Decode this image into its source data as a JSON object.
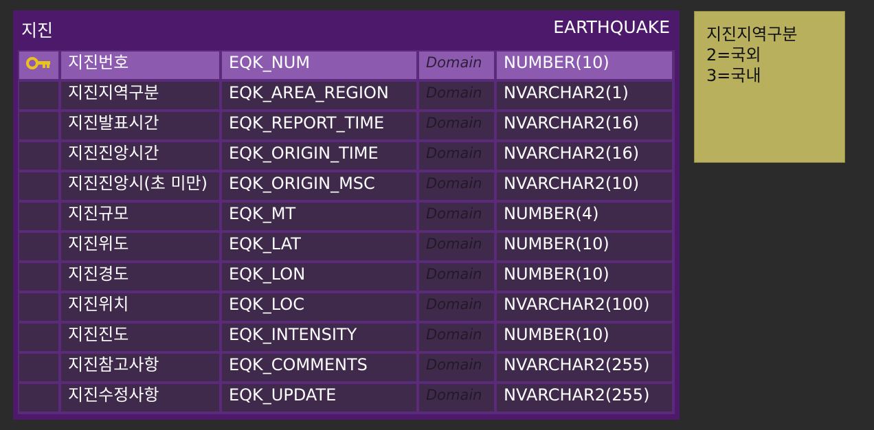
{
  "entity": {
    "logical_name": "지진",
    "physical_name": "EARTHQUAKE",
    "columns": [
      {
        "logical": "지진번호",
        "physical": "EQK_NUM",
        "domain": "Domain",
        "type": "NUMBER(10)",
        "pk": true
      },
      {
        "logical": "지진지역구분",
        "physical": "EQK_AREA_REGION",
        "domain": "Domain",
        "type": "NVARCHAR2(1)",
        "pk": false
      },
      {
        "logical": "지진발표시간",
        "physical": "EQK_REPORT_TIME",
        "domain": "Domain",
        "type": "NVARCHAR2(16)",
        "pk": false
      },
      {
        "logical": "지진진앙시간",
        "physical": "EQK_ORIGIN_TIME",
        "domain": "Domain",
        "type": "NVARCHAR2(16)",
        "pk": false
      },
      {
        "logical": "지진진앙시(초 미만)",
        "physical": "EQK_ORIGIN_MSC",
        "domain": "Domain",
        "type": "NVARCHAR2(10)",
        "pk": false
      },
      {
        "logical": "지진규모",
        "physical": "EQK_MT",
        "domain": "Domain",
        "type": "NUMBER(4)",
        "pk": false
      },
      {
        "logical": "지진위도",
        "physical": "EQK_LAT",
        "domain": "Domain",
        "type": "NUMBER(10)",
        "pk": false
      },
      {
        "logical": "지진경도",
        "physical": "EQK_LON",
        "domain": "Domain",
        "type": "NUMBER(10)",
        "pk": false
      },
      {
        "logical": "지진위치",
        "physical": "EQK_LOC",
        "domain": "Domain",
        "type": "NVARCHAR2(100)",
        "pk": false
      },
      {
        "logical": "지진진도",
        "physical": "EQK_INTENSITY",
        "domain": "Domain",
        "type": "NUMBER(10)",
        "pk": false
      },
      {
        "logical": "지진참고사항",
        "physical": "EQK_COMMENTS",
        "domain": "Domain",
        "type": "NVARCHAR2(255)",
        "pk": false
      },
      {
        "logical": "지진수정사항",
        "physical": "EQK_UPDATE",
        "domain": "Domain",
        "type": "NVARCHAR2(255)",
        "pk": false
      }
    ]
  },
  "note": {
    "lines": [
      "지진지역구분",
      "2=국외",
      "3=국내"
    ]
  },
  "colors": {
    "entity_background": "#4d1a6b",
    "row_background": "#3f2a4b",
    "pk_row_background": "#8c5bb0",
    "note_background": "#b8b05c",
    "key_icon": "#e8c31f"
  },
  "icons": {
    "primary_key": "key-icon"
  }
}
